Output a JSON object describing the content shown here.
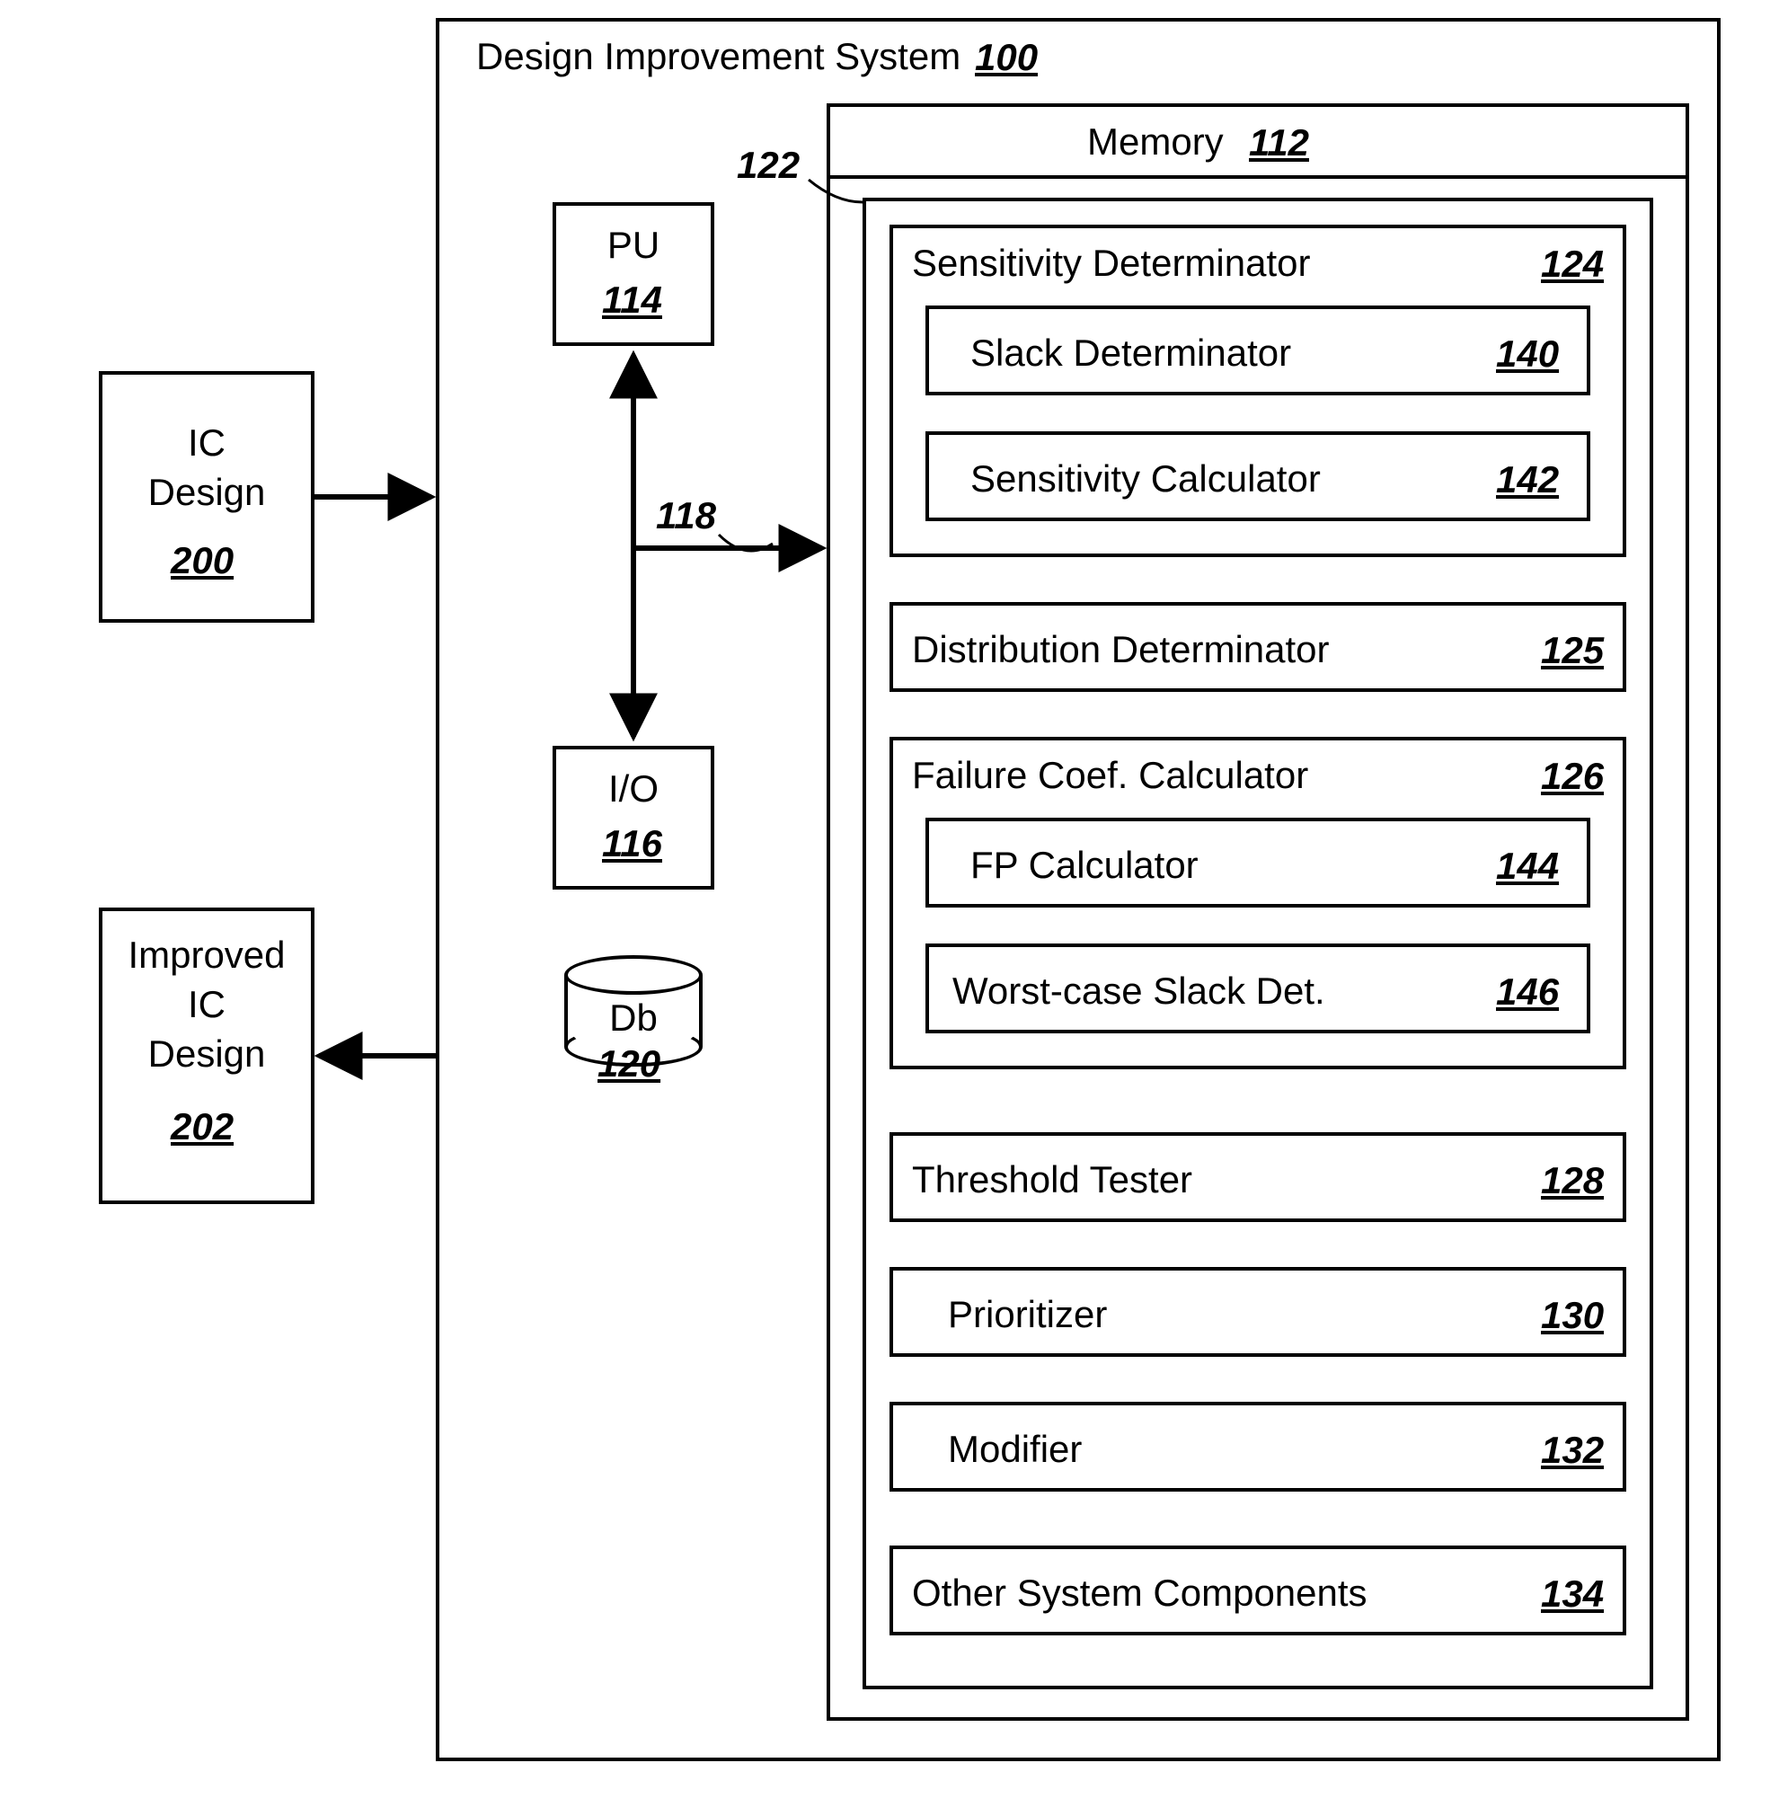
{
  "system": {
    "title": "Design Improvement System",
    "ref": "100"
  },
  "memory": {
    "title": "Memory",
    "ref": "112"
  },
  "program": {
    "ref": "122"
  },
  "bus": {
    "ref": "118"
  },
  "pu": {
    "label": "PU",
    "ref": "114"
  },
  "io": {
    "label": "I/O",
    "ref": "116"
  },
  "db": {
    "label": "Db",
    "ref": "120"
  },
  "ic_design": {
    "line1": "IC",
    "line2": "Design",
    "ref": "200"
  },
  "improved_ic_design": {
    "line1": "Improved",
    "line2": "IC",
    "line3": "Design",
    "ref": "202"
  },
  "sensitivity": {
    "label": "Sensitivity Determinator",
    "ref": "124"
  },
  "slack": {
    "label": "Slack Determinator",
    "ref": "140"
  },
  "senscalc": {
    "label": "Sensitivity Calculator",
    "ref": "142"
  },
  "distribution": {
    "label": "Distribution Determinator",
    "ref": "125"
  },
  "failure": {
    "label": "Failure Coef. Calculator",
    "ref": "126"
  },
  "fp": {
    "label": "FP Calculator",
    "ref": "144"
  },
  "worst": {
    "label": "Worst-case Slack Det.",
    "ref": "146"
  },
  "threshold": {
    "label": "Threshold Tester",
    "ref": "128"
  },
  "prioritizer": {
    "label": "Prioritizer",
    "ref": "130"
  },
  "modifier": {
    "label": "Modifier",
    "ref": "132"
  },
  "other": {
    "label": "Other System Components",
    "ref": "134"
  }
}
